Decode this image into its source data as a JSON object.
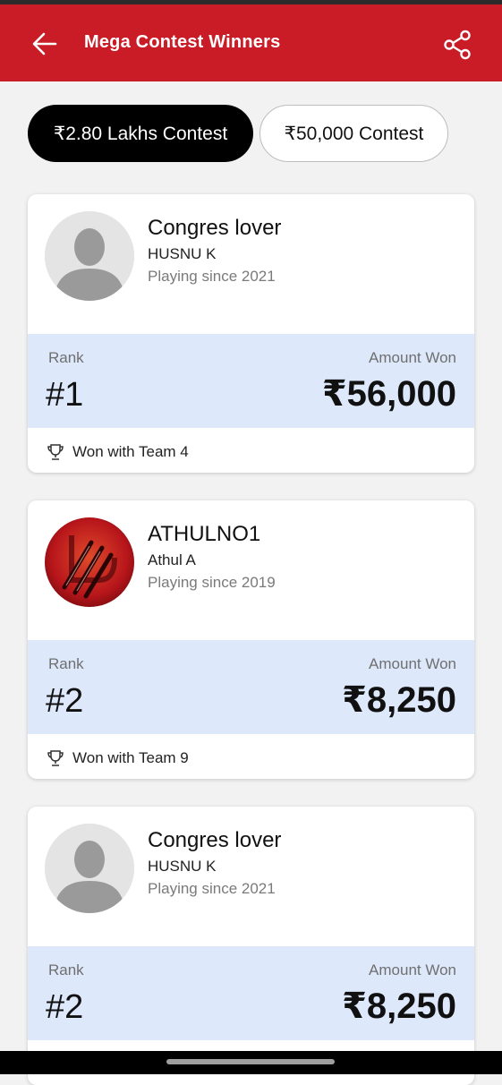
{
  "header": {
    "title": "Mega Contest Winners",
    "back_icon": "arrow-left-icon",
    "share_icon": "share-icon"
  },
  "tabs": [
    {
      "label": "₹2.80 Lakhs Contest",
      "active": true
    },
    {
      "label": "₹50,000 Contest",
      "active": false
    }
  ],
  "labels": {
    "rank": "Rank",
    "amount_won": "Amount Won"
  },
  "winners": [
    {
      "username": "Congres lover",
      "name": "HUSNU K",
      "since": "Playing since 2021",
      "rank": "#1",
      "amount": "₹56,000",
      "team": "Won with Team 4",
      "avatar": "default-person-avatar"
    },
    {
      "username": "ATHULNO1",
      "name": "Athul A",
      "since": "Playing since 2019",
      "rank": "#2",
      "amount": "₹8,250",
      "team": "Won with Team 9",
      "avatar": "red-claw-avatar"
    },
    {
      "username": "Congres lover",
      "name": "HUSNU K",
      "since": "Playing since 2021",
      "rank": "#2",
      "amount": "₹8,250",
      "team": "",
      "avatar": "default-person-avatar"
    }
  ],
  "colors": {
    "header_bg": "#c91c26",
    "stats_bg": "#dde9fb",
    "active_tab_bg": "#000000"
  }
}
